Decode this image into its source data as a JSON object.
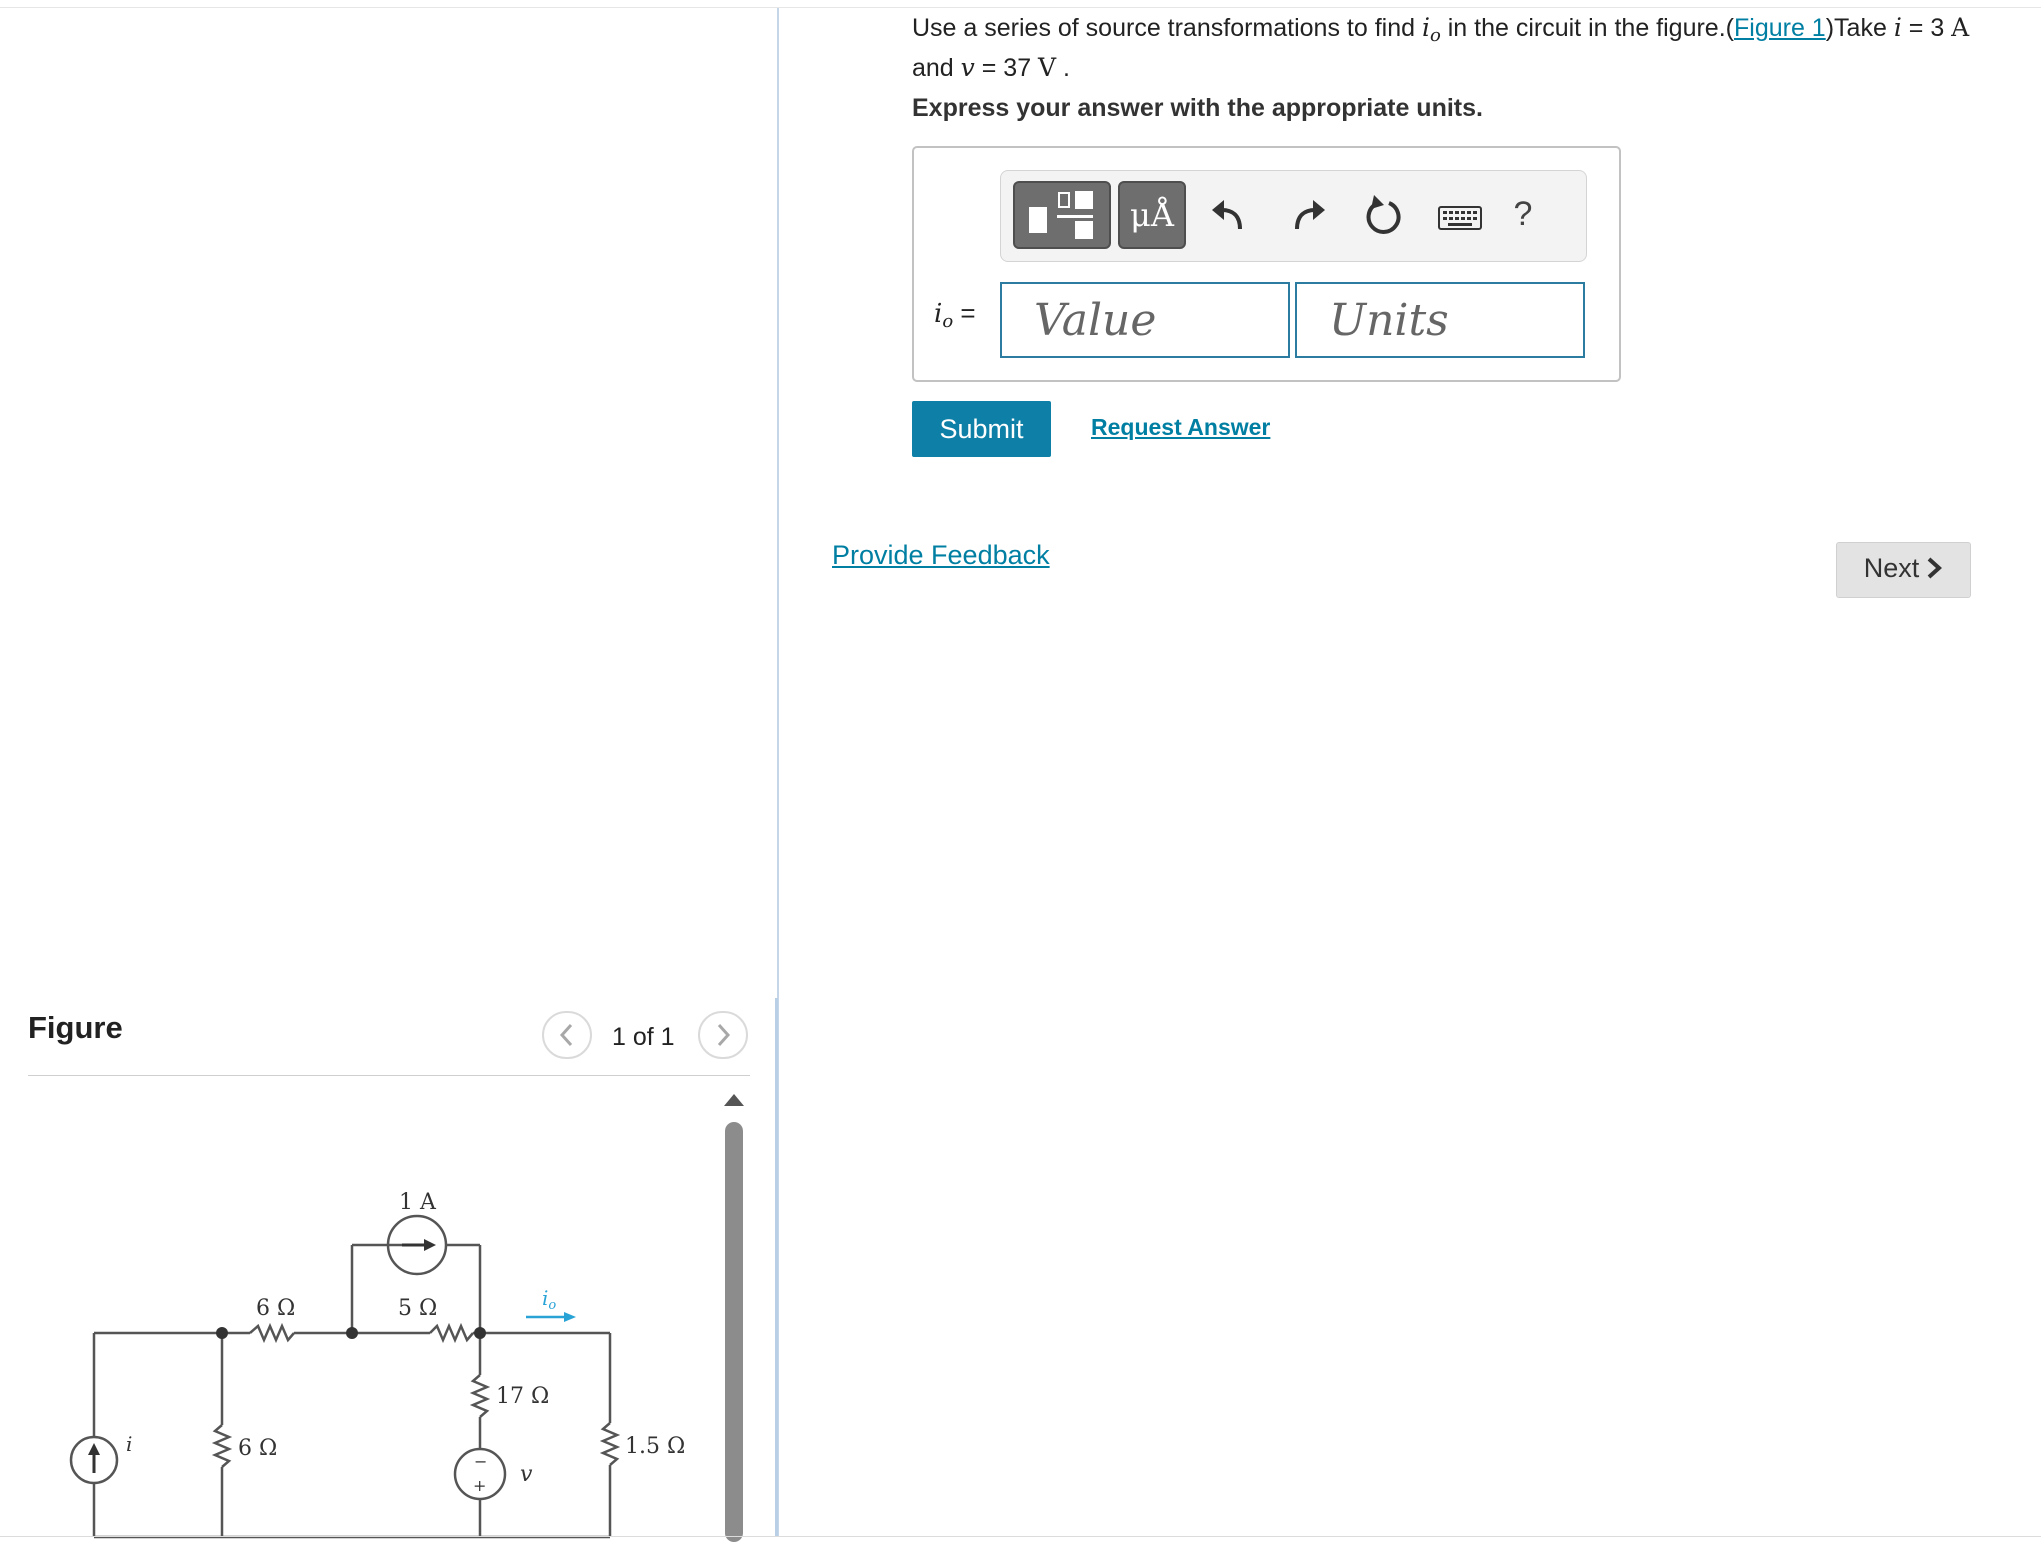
{
  "question": {
    "text_before": "Use a series of source transformations to find ",
    "io_sym": "i",
    "io_sub": "o",
    "text_mid": " in the circuit in the figure.(",
    "figure_link": "Figure 1",
    "text_take": ")Take ",
    "i_sym": "i",
    "eq1": " = ",
    "i_num": "3 ",
    "i_unit": "A",
    "and": " and ",
    "v_sym": "v",
    "eq2": " = 37 ",
    "v_unit": "V",
    "end": " ."
  },
  "instruction": "Express your answer with the appropriate units.",
  "toolbar": {
    "units_button": "μÅ",
    "help": "?"
  },
  "answer": {
    "label_sym": "i",
    "label_sub": "o",
    "label_eq": " =",
    "value_placeholder": "Value",
    "units_placeholder": "Units"
  },
  "actions": {
    "submit": "Submit",
    "request_answer": "Request Answer"
  },
  "feedback_link": "Provide Feedback",
  "next_label": "Next",
  "figure": {
    "title": "Figure",
    "pager": "1 of 1",
    "labels": {
      "current_source_top": "1 A",
      "r_top_left": "6 Ω",
      "r_top_mid": "5 Ω",
      "r_vertical_left": "6 Ω",
      "r_vertical_mid": "17 Ω",
      "r_vertical_right": "1.5 Ω",
      "source_i": "i",
      "source_v": "v",
      "current_io": "i",
      "current_io_sub": "o",
      "plus": "+",
      "minus": "−"
    }
  },
  "colors": {
    "primary": "#0e7fa6",
    "link": "#007fa3",
    "input_border": "#2c7ba0",
    "io_arrow": "#29a3d6"
  }
}
